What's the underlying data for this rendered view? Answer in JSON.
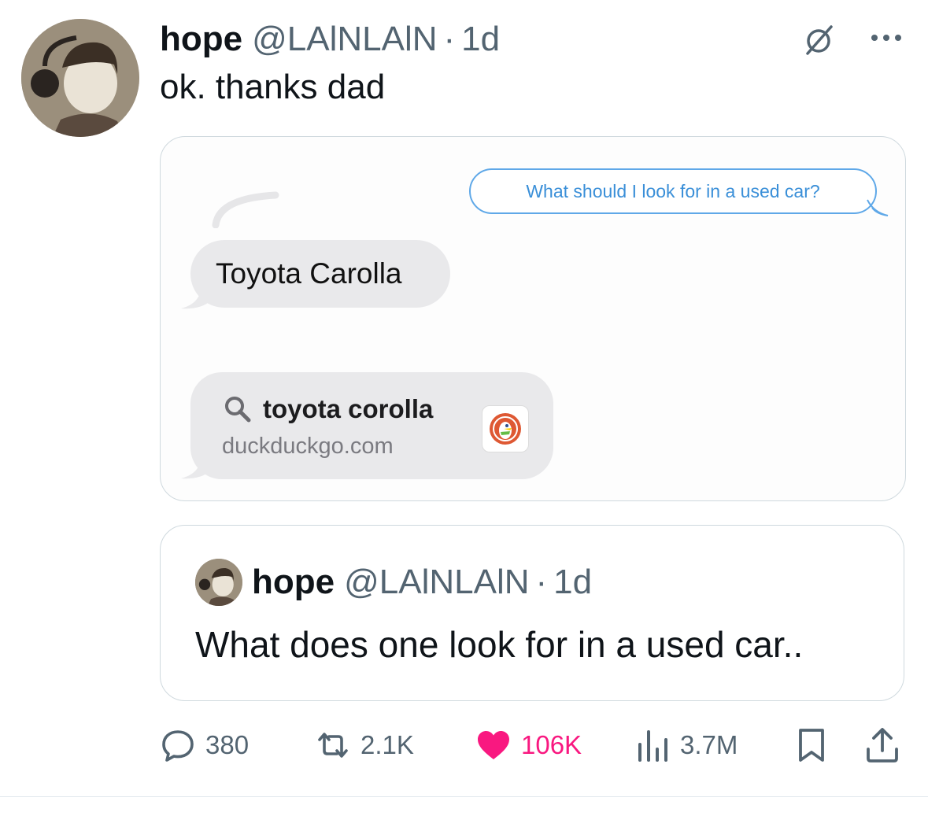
{
  "colors": {
    "accent": "#1d9bf0",
    "like": "#f91880",
    "muted": "#536471",
    "bubble_outline": "#5fa8e8",
    "bubble_gray": "#e9e9eb",
    "ddg_orange": "#de5833"
  },
  "tweet": {
    "name": "hope",
    "handle": "@LAlNLAlN",
    "dot": "·",
    "time": "1d",
    "text": "ok. thanks dad",
    "icons": {
      "avatar": "avatar-photo",
      "grok": "grok-icon",
      "more": "more-icon"
    }
  },
  "media": {
    "outgoing_message": "What should I look for in a used car?",
    "incoming_message": "Toyota Carolla",
    "link_preview": {
      "query": "toyota corolla",
      "domain": "duckduckgo.com",
      "icon": "duckduckgo-icon"
    }
  },
  "quoted_tweet": {
    "name": "hope",
    "handle": "@LAlNLAlN",
    "dot": "·",
    "time": "1d",
    "text": "What does one look for in a used car.."
  },
  "actions": {
    "replies": "380",
    "reposts": "2.1K",
    "likes": "106K",
    "views": "3.7M",
    "icons": [
      "reply-icon",
      "repost-icon",
      "like-icon",
      "views-icon",
      "bookmark-icon",
      "share-icon"
    ]
  }
}
